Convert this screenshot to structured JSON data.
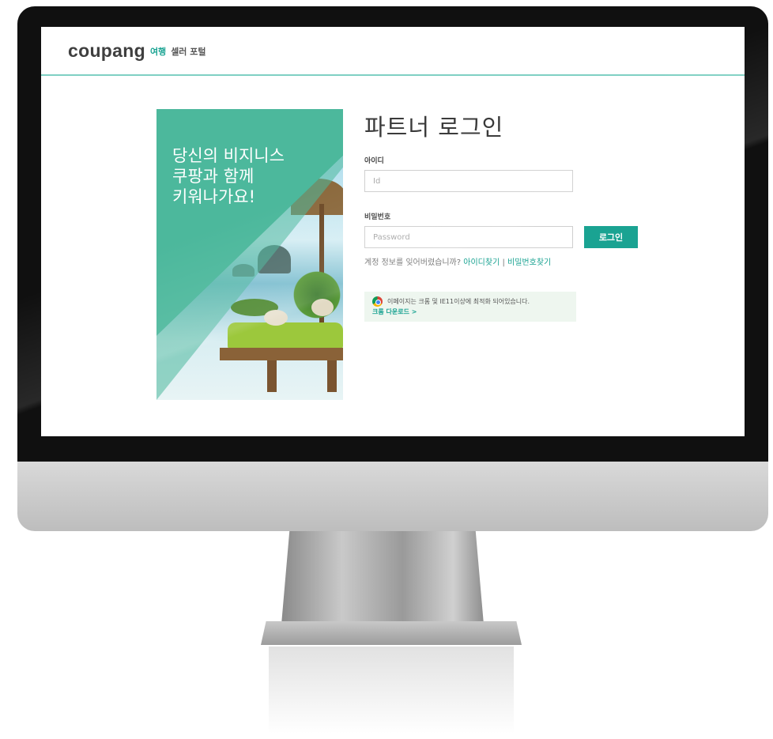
{
  "header": {
    "logo": "coupang",
    "subtitle_accent": "여행",
    "subtitle": "셀러 포털"
  },
  "banner": {
    "slogan": [
      "당신의 비지니스",
      "쿠팡과 함께",
      "키워나가요!"
    ]
  },
  "login": {
    "title": "파트너 로그인",
    "id_label": "아이디",
    "id_placeholder": "Id",
    "password_label": "비밀번호",
    "password_placeholder": "Password",
    "login_button": "로그인",
    "help_text": "계정 정보를 잊어버렸습니까?",
    "find_id": "아이디찾기",
    "separator": "|",
    "find_password": "비밀번호찾기"
  },
  "notice": {
    "icon": "chrome-icon",
    "text": "이페이지는 크롬 및 IE11이상에 최적화 되어있습니다.",
    "download_link": "크롬 다운로드 >"
  },
  "colors": {
    "brand": "#1aa392",
    "header_line": "#7fd0c3",
    "banner_teal": "#4cb89c"
  }
}
